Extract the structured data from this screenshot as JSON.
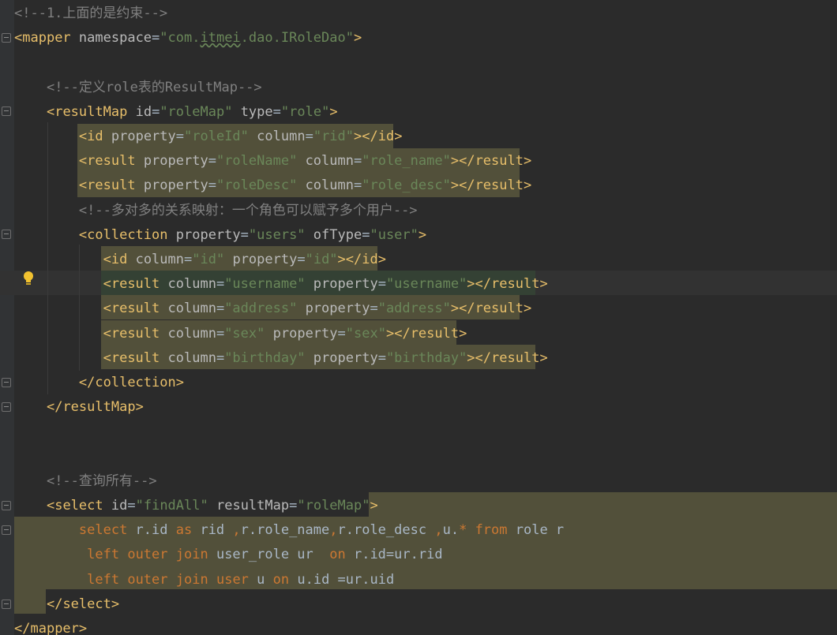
{
  "editor": {
    "language": "xml",
    "lines": [
      {
        "text": "<!--1.上面的是约束-->"
      },
      {
        "text": "<mapper namespace=\"com.itmei.dao.IRoleDao\">"
      },
      {
        "text": ""
      },
      {
        "text": "    <!--定义role表的ResultMap-->"
      },
      {
        "text": "    <resultMap id=\"roleMap\" type=\"role\">"
      },
      {
        "text": "        <id property=\"roleId\" column=\"rid\"></id>"
      },
      {
        "text": "        <result property=\"roleName\" column=\"role_name\"></result>"
      },
      {
        "text": "        <result property=\"roleDesc\" column=\"role_desc\"></result>"
      },
      {
        "text": "        <!--多对多的关系映射：一个角色可以赋予多个用户-->"
      },
      {
        "text": "        <collection property=\"users\" ofType=\"user\">"
      },
      {
        "text": "           <id column=\"id\" property=\"id\"></id>"
      },
      {
        "text": "           <result column=\"username\" property=\"username\"></result>"
      },
      {
        "text": "           <result column=\"address\" property=\"address\"></result>"
      },
      {
        "text": "           <result column=\"sex\" property=\"sex\"></result>"
      },
      {
        "text": "           <result column=\"birthday\" property=\"birthday\"></result>"
      },
      {
        "text": "        </collection>"
      },
      {
        "text": "    </resultMap>"
      },
      {
        "text": ""
      },
      {
        "text": ""
      },
      {
        "text": "    <!--查询所有-->"
      },
      {
        "text": "    <select id=\"findAll\" resultMap=\"roleMap\">"
      },
      {
        "text": "        select r.id as rid ,r.role_name,r.role_desc ,u.* from role r"
      },
      {
        "text": "         left outer join user_role ur  on r.id=ur.rid"
      },
      {
        "text": "         left outer join user u on u.id =ur.uid"
      },
      {
        "text": "    </select>"
      },
      {
        "text": "</mapper>"
      }
    ]
  },
  "colors": {
    "background": "#2b2b2b",
    "tag": "#e8bf6a",
    "attribute": "#bababa",
    "value": "#6a8759",
    "comment": "#808080",
    "keyword": "#cc7832",
    "text": "#a9b7c6",
    "highlight": "#52503a"
  },
  "icons": {
    "gutter_bulb": "lightbulb-icon",
    "fold": "fold-marker-icon"
  }
}
